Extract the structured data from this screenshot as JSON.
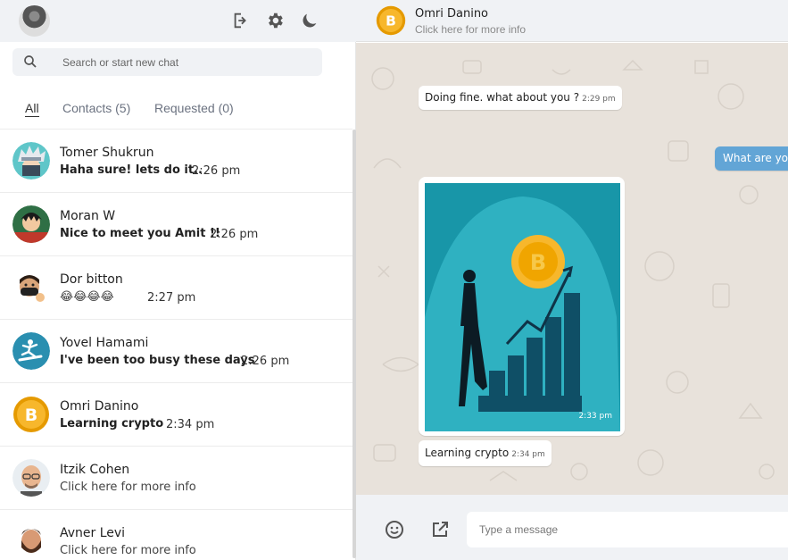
{
  "sidebar": {
    "search": {
      "placeholder": "Search or start new chat"
    },
    "filters": [
      {
        "label": "All"
      },
      {
        "label": "Contacts (5)"
      },
      {
        "label": "Requested (0)"
      }
    ],
    "chats": [
      {
        "name": "Tomer Shukrun",
        "preview": "Haha sure! lets do it..",
        "time": "2:26 pm",
        "avatar": "anime-ninja-avatar"
      },
      {
        "name": "Moran W",
        "preview": "Nice to meet you Amit !!",
        "time": "2:26 pm",
        "avatar": "pirate-anime-avatar"
      },
      {
        "name": "Dor bitton",
        "preview": "😂😂😂😂",
        "time": "2:27 pm",
        "avatar": "masked-emoji-avatar"
      },
      {
        "name": "Yovel Hamami",
        "preview": "I've been too busy these days",
        "time": "2:26 pm",
        "avatar": "skater-avatar"
      },
      {
        "name": "Omri Danino",
        "preview": "Learning crypto",
        "time": "2:34 pm",
        "avatar": "bitcoin-avatar"
      },
      {
        "name": "Itzik Cohen",
        "preview": "Click here for more info",
        "time": "",
        "avatar": "bald-emoji-avatar"
      },
      {
        "name": "Avner Levi",
        "preview": "Click here for more info",
        "time": "",
        "avatar": "bearded-emoji-avatar"
      }
    ]
  },
  "chat": {
    "contact_name": "Omri Danino",
    "contact_sub": "Click here for more info",
    "messages": [
      {
        "text": "Doing fine. what about you ?",
        "time": "2:29 pm",
        "direction": "in"
      },
      {
        "text": "What are you",
        "time": "",
        "direction": "out"
      },
      {
        "text": "",
        "time": "2:33 pm",
        "direction": "in",
        "kind": "image"
      },
      {
        "text": "Learning crypto",
        "time": "2:34 pm",
        "direction": "in"
      }
    ],
    "composer": {
      "placeholder": "Type a message"
    }
  },
  "colors": {
    "header_bg": "#f0f2f5",
    "chat_bg": "#e8e2db",
    "outgoing_bubble": "#62a5d6",
    "image_bg": "#1896a8",
    "bitcoin": "#f2a900"
  }
}
